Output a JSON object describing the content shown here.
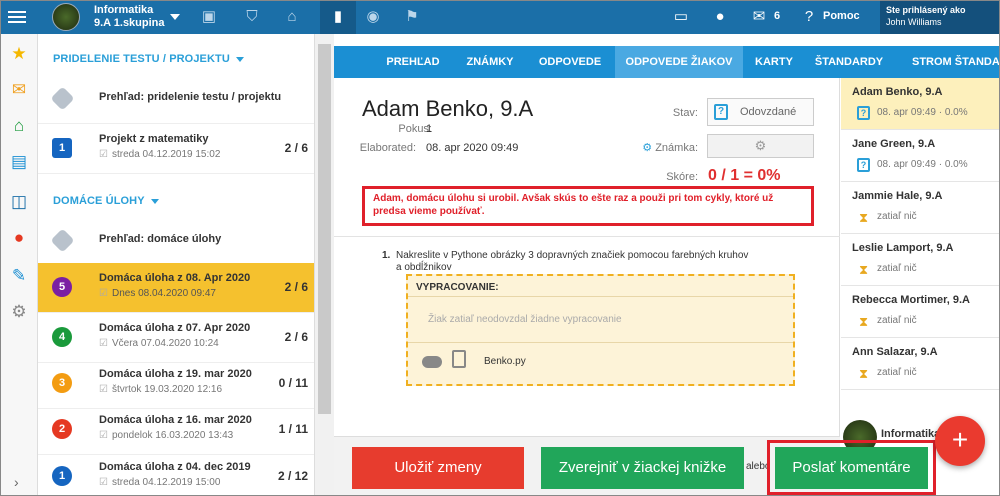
{
  "topbar": {
    "course_name": "Informatika",
    "course_group": "9.A 1.skupina",
    "messages_count": "6",
    "help_label": "Pomoc",
    "user_label": "Ste prihlásený ako",
    "user_name": "John Williams"
  },
  "left_panel": {
    "tests_header": "PRIDELENIE TESTU / PROJEKTU",
    "tests_items": [
      {
        "title": "Prehľad: pridelenie testu / projektu"
      },
      {
        "badge": "1",
        "title": "Projekt z matematiky",
        "sub": "streda 04.12.2019 15:02",
        "count": "2 / 6"
      }
    ],
    "homework_header": "DOMÁCE ÚLOHY",
    "homework_items": [
      {
        "title": "Prehľad: domáce úlohy"
      },
      {
        "badge": "5",
        "title": "Domáca úloha z 08. Apr 2020",
        "sub": "Dnes 08.04.2020 09:47",
        "count": "2 / 6",
        "color": "#7b1fa2"
      },
      {
        "badge": "4",
        "title": "Domáca úloha z 07. Apr 2020",
        "sub": "Včera 07.04.2020 10:24",
        "count": "2 / 6",
        "color": "#1a9a3b"
      },
      {
        "badge": "3",
        "title": "Domáca úloha z 19. mar 2020",
        "sub": "štvrtok 19.03.2020 12:16",
        "count": "0 / 11",
        "color": "#f39c12"
      },
      {
        "badge": "2",
        "title": "Domáca úloha z 16. mar 2020",
        "sub": "pondelok 16.03.2020 13:43",
        "count": "1 / 11",
        "color": "#e53922"
      },
      {
        "badge": "1",
        "title": "Domáca úloha z 04. dec 2019",
        "sub": "streda 04.12.2019 15:00",
        "count": "2 / 12",
        "color": "#1565c0"
      }
    ]
  },
  "tabs": [
    "PREHĽAD",
    "ZNÁMKY",
    "ODPOVEDE",
    "ODPOVEDE ŽIAKOV",
    "KARTY",
    "ŠTANDARDY",
    "STROM ŠTANDARDOV"
  ],
  "detail": {
    "student_name": "Adam Benko, 9.A",
    "attempt_label": "Pokus:",
    "attempt_value": "1",
    "elaborated_label": "Elaborated:",
    "elaborated_value": "08. apr 2020 09:49",
    "status_label": "Stav:",
    "status_value": "Odovzdané",
    "grade_label": "Známka:",
    "score_label": "Skóre:",
    "score_value": "0 / 1 = 0%",
    "comment": "Adam, domácu úlohu si urobil. Avšak skús to ešte raz a použi pri tom cykly, ktoré už predsa vieme používať.",
    "task_number": "1.",
    "task_text": "Nakreslite v Pythone obrázky 3 dopravných značiek pomocou farebných kruhov a obdĺžnikov",
    "answer_header": "VYPRACOVANIE:",
    "answer_empty": "Žiak zatiaľ neodovzdal žiadne vypracovanie",
    "file_name": "Benko.py"
  },
  "students": [
    {
      "name": "Adam Benko, 9.A",
      "info": "08. apr 09:49 · 0.0%",
      "submitted": true
    },
    {
      "name": "Jane Green, 9.A",
      "info": "08. apr 09:49 · 0.0%",
      "submitted": true
    },
    {
      "name": "Jammie Hale, 9.A",
      "info": "zatiaľ nič",
      "submitted": false
    },
    {
      "name": "Leslie Lamport, 9.A",
      "info": "zatiaľ nič",
      "submitted": false
    },
    {
      "name": "Rebecca Mortimer, 9.A",
      "info": "zatiaľ nič",
      "submitted": false
    },
    {
      "name": "Ann Salazar, 9.A",
      "info": "zatiaľ nič",
      "submitted": false
    }
  ],
  "students_footer": "Informatika",
  "buttons": {
    "save": "Uložiť zmeny",
    "publish": "Zverejniť v žiackej knižke",
    "or": "alebo",
    "send_comment": "Poslať komentáre",
    "fab": "+"
  }
}
